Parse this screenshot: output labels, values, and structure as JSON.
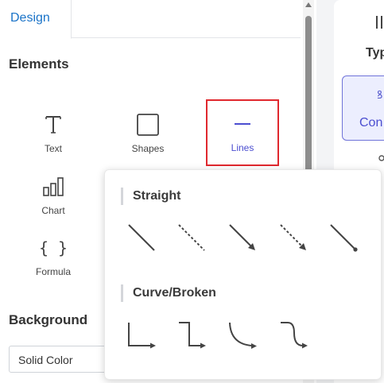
{
  "tabs": {
    "design": "Design"
  },
  "elements": {
    "title": "Elements",
    "items": [
      {
        "label": "Text",
        "icon": "text-icon"
      },
      {
        "label": "Shapes",
        "icon": "square-icon"
      },
      {
        "label": "Lines",
        "icon": "line-icon",
        "selected": true
      },
      {
        "label": "Chart",
        "icon": "chart-icon"
      },
      {
        "label": "Formula",
        "icon": "braces-icon"
      }
    ]
  },
  "background": {
    "title": "Background",
    "select_value": "Solid Color"
  },
  "right_panel": {
    "type_label": "Typ",
    "button_label": "Con"
  },
  "line_popup": {
    "straight_title": "Straight",
    "straight_options": [
      "line-icon",
      "dashed-line-icon",
      "arrow-line-icon",
      "dashed-arrow-line-icon",
      "dot-end-line-icon"
    ],
    "curve_title": "Curve/Broken",
    "curve_options": [
      "elbow-arrow-icon",
      "step-arrow-icon",
      "curve-arrow-icon",
      "s-curve-arrow-icon"
    ]
  },
  "colors": {
    "accent": "#4b4ed0",
    "tab_blue": "#1a73c8",
    "highlight_red": "#e0282e"
  }
}
